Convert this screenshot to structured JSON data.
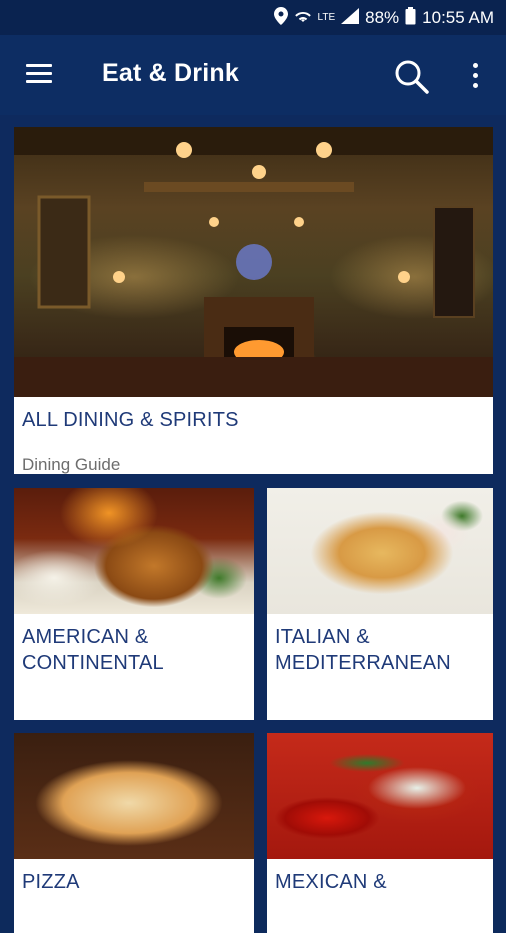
{
  "status_bar": {
    "battery": "88%",
    "time": "10:55 AM",
    "icons": [
      "location-icon",
      "wifi-icon",
      "lte-icon",
      "signal-icon",
      "battery-icon"
    ]
  },
  "app_bar": {
    "title": "Eat & Drink",
    "icons": [
      "menu-icon",
      "search-icon",
      "more-vert-icon"
    ]
  },
  "cards": [
    {
      "title": "ALL DINING & SPIRITS",
      "subtitle": "Dining Guide",
      "image": "restaurant-interior"
    },
    {
      "title": "AMERICAN & CONTINENTAL",
      "image": "roast-turkey"
    },
    {
      "title": "ITALIAN & MEDITERRANEAN",
      "image": "pasta-dish"
    },
    {
      "title": "PIZZA",
      "image": "pizza"
    },
    {
      "title": "MEXICAN &",
      "image": "chili-and-salsa"
    }
  ],
  "colors": {
    "status_bar_bg": "#0a2350",
    "app_bar_bg": "#0d2d63",
    "content_bg": "#0e2a5e",
    "card_title": "#1f3a78"
  }
}
